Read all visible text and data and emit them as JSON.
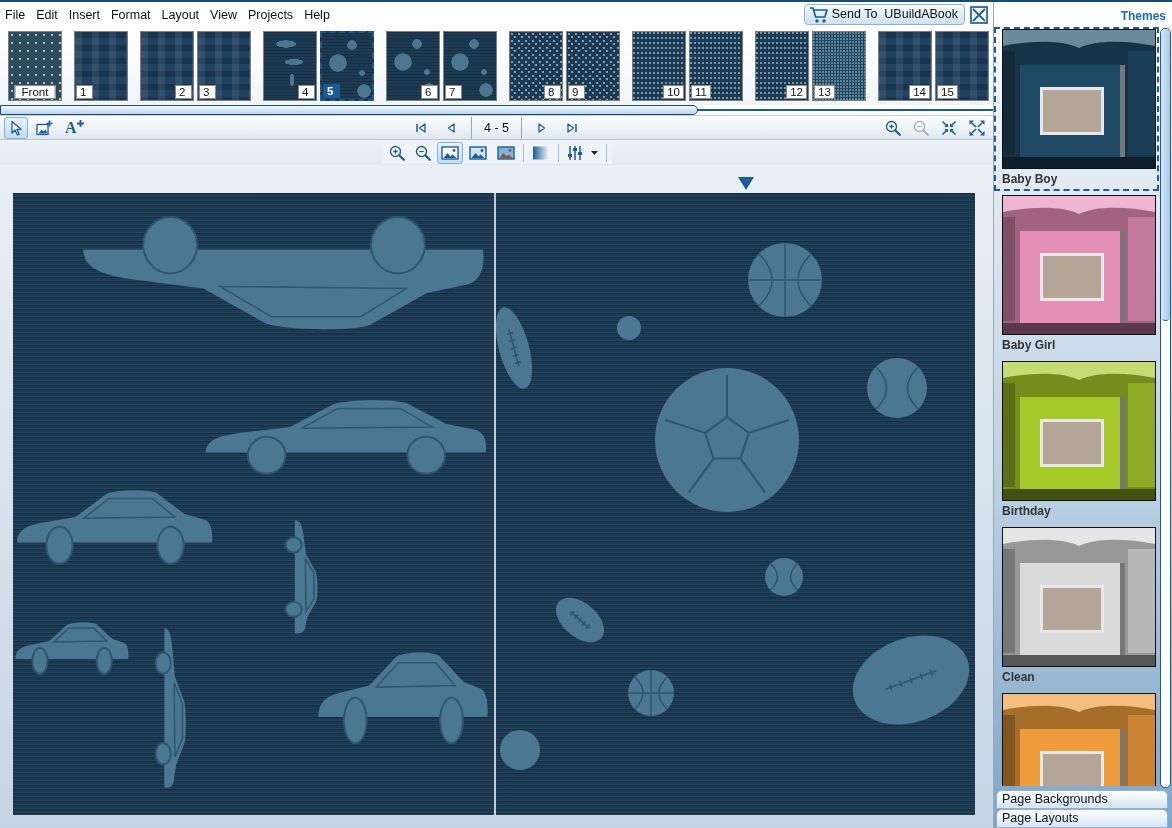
{
  "menu": [
    "File",
    "Edit",
    "Insert",
    "Format",
    "Layout",
    "View",
    "Projects",
    "Help"
  ],
  "send_button": {
    "label": "Send To  UBuildABook"
  },
  "page_strip": {
    "spreads": [
      {
        "pages": [
          {
            "label": "Front",
            "cover": true,
            "kind": "dots",
            "selected": false
          }
        ]
      },
      {
        "pages": [
          {
            "label": "1",
            "cover": false,
            "kind": "blocks",
            "selected": false
          }
        ]
      },
      {
        "pages": [
          {
            "label": "2",
            "cover": false,
            "kind": "blocks",
            "selected": false
          },
          {
            "label": "3",
            "cover": false,
            "kind": "blocks",
            "selected": false
          }
        ]
      },
      {
        "pages": [
          {
            "label": "4",
            "cover": false,
            "kind": "cars",
            "selected": false
          },
          {
            "label": "5",
            "cover": false,
            "kind": "balls",
            "selected": true
          }
        ]
      },
      {
        "pages": [
          {
            "label": "6",
            "cover": false,
            "kind": "balls",
            "selected": false
          },
          {
            "label": "7",
            "cover": false,
            "kind": "balls",
            "selected": false
          }
        ]
      },
      {
        "pages": [
          {
            "label": "8",
            "cover": false,
            "kind": "glyphs",
            "selected": false
          },
          {
            "label": "9",
            "cover": false,
            "kind": "glyphs",
            "selected": false
          }
        ]
      },
      {
        "pages": [
          {
            "label": "10",
            "cover": false,
            "kind": "speckle",
            "selected": false
          },
          {
            "label": "11",
            "cover": false,
            "kind": "speckle",
            "selected": false
          }
        ]
      },
      {
        "pages": [
          {
            "label": "12",
            "cover": false,
            "kind": "speckle",
            "selected": false
          },
          {
            "label": "13",
            "cover": false,
            "kind": "fine",
            "selected": false
          }
        ]
      },
      {
        "pages": [
          {
            "label": "14",
            "cover": false,
            "kind": "blocks",
            "selected": false
          },
          {
            "label": "15",
            "cover": false,
            "kind": "blocks",
            "selected": false
          }
        ]
      }
    ]
  },
  "edit_toolbar": {
    "tools": [
      {
        "kind": "select",
        "selected": true
      },
      {
        "kind": "add-image",
        "selected": false
      },
      {
        "kind": "add-text",
        "glyph": "A",
        "selected": false
      }
    ],
    "page_range": "4 - 5",
    "view_tools": [
      {
        "kind": "zoom-in",
        "disabled": false
      },
      {
        "kind": "zoom-out",
        "disabled": true
      },
      {
        "kind": "fit",
        "disabled": false
      },
      {
        "kind": "fullscreen",
        "disabled": false
      }
    ]
  },
  "image_toolbar": {
    "zoom_tools": [
      {
        "kind": "zoom-in"
      },
      {
        "kind": "zoom-out"
      }
    ],
    "modes": [
      {
        "kind": "frame",
        "selected": true
      },
      {
        "kind": "fill",
        "selected": false
      },
      {
        "kind": "photo",
        "selected": false
      }
    ],
    "effects": [
      {
        "kind": "gradient"
      },
      {
        "kind": "adjust"
      }
    ]
  },
  "themes": {
    "title": "Themes",
    "items": [
      {
        "name": "Baby Boy",
        "color": "#1f4a66",
        "selected": true
      },
      {
        "name": "Baby Girl",
        "color": "#e58fb8",
        "selected": false
      },
      {
        "name": "Birthday",
        "color": "#a6c92a",
        "selected": false
      },
      {
        "name": "Clean",
        "color": "#d9d9d9",
        "selected": false
      },
      {
        "color": "#ee9b3c",
        "selected": false
      }
    ]
  },
  "panel_tabs": [
    {
      "label": "Page Backgrounds"
    },
    {
      "label": "Page Layouts"
    }
  ]
}
